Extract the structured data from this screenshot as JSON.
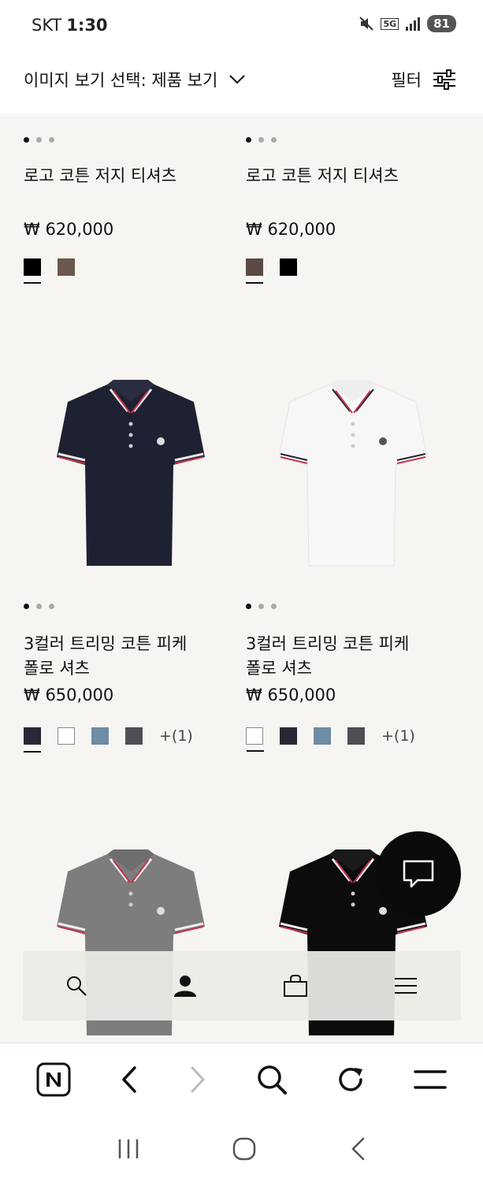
{
  "status_bar": {
    "carrier": "SKT",
    "time": "1:30",
    "network": "5G",
    "battery": "81"
  },
  "header": {
    "view_select_label": "이미지 보기 선택: 제품 보기",
    "filter_label": "필터"
  },
  "products": [
    {
      "name": "로고 코튼 저지 티셔츠",
      "price": "₩ 620,000",
      "swatches": [
        "#000000",
        "#6b574d"
      ]
    },
    {
      "name": "로고 코튼 저지 티셔츠",
      "price": "₩ 620,000",
      "swatches": [
        "#5b4a42",
        "#000000"
      ]
    },
    {
      "name": "3컬러 트리밍 코튼 피케 폴로 셔츠",
      "name_line1": "3컬러 트리밍 코튼 피케",
      "name_line2": "폴로 셔츠",
      "price": "₩ 650,000",
      "swatches": [
        "#2a2633",
        "#ffffff",
        "#6f8ca6",
        "#4d4f55"
      ],
      "more": "+(1)",
      "shirt_color": "#1e2132"
    },
    {
      "name": "3컬러 트리밍 코튼 피케 폴로 셔츠",
      "name_line1": "3컬러 트리밍 코튼 피케",
      "name_line2": "폴로 셔츠",
      "price": "₩ 650,000",
      "swatches": [
        "#ffffff",
        "#2a2633",
        "#6f8ca6",
        "#4d4f55"
      ],
      "more": "+(1)",
      "shirt_color": "#f7f7f7"
    },
    {
      "shirt_color": "#7d7d7d"
    },
    {
      "shirt_color": "#0c0c0c"
    }
  ],
  "icons": {
    "chat": "chat-bubble-icon",
    "bottom_nav": [
      "search-icon",
      "account-icon",
      "shopping-bag-icon",
      "menu-icon"
    ],
    "browser": [
      "naver-n-icon",
      "back-arrow-icon",
      "forward-arrow-icon",
      "search-icon",
      "refresh-icon",
      "menu-icon"
    ],
    "system": [
      "recent-apps-icon",
      "home-icon",
      "back-icon"
    ]
  },
  "colors": {
    "background": "#f6f5f1",
    "stripe_red": "#c8334b",
    "stripe_white": "#ffffff"
  }
}
